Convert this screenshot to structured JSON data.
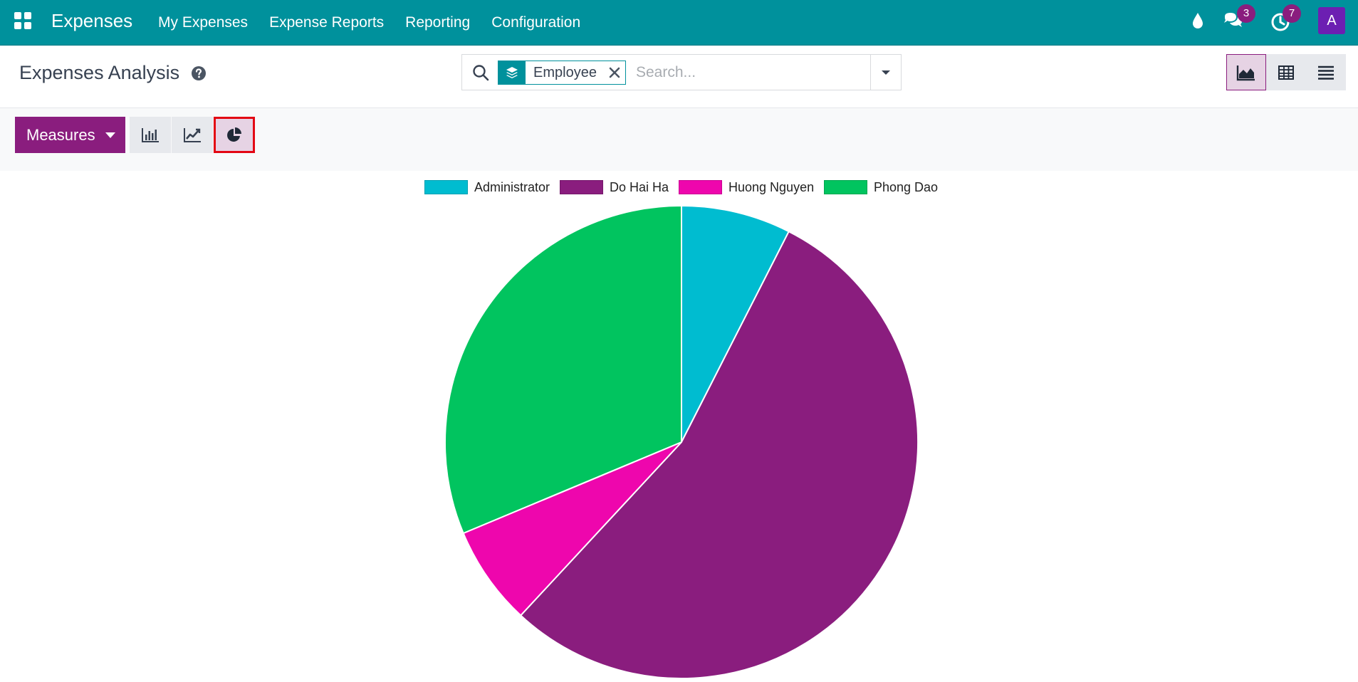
{
  "navbar": {
    "app_name": "Expenses",
    "menu": [
      "My Expenses",
      "Expense Reports",
      "Reporting",
      "Configuration"
    ],
    "messages_count": "3",
    "activities_count": "7",
    "avatar_letter": "A"
  },
  "control_panel": {
    "title": "Expenses Analysis",
    "search": {
      "facet_label": "Employee",
      "placeholder": "Search..."
    }
  },
  "graph_toolbar": {
    "measures_label": "Measures",
    "active_type": "pie"
  },
  "colors": {
    "brand": "#00919c",
    "accent": "#8a1d7e",
    "highlight": "#e30613"
  },
  "chart_data": {
    "type": "pie",
    "title": "",
    "legend_position": "top",
    "series": [
      {
        "name": "Administrator",
        "value": 7.5,
        "color": "#00bcd0"
      },
      {
        "name": "Do Hai Ha",
        "value": 54.4,
        "color": "#8a1d7e"
      },
      {
        "name": "Huong Nguyen",
        "value": 6.8,
        "color": "#ee06ad"
      },
      {
        "name": "Phong Dao",
        "value": 31.3,
        "color": "#01c45f"
      }
    ]
  }
}
